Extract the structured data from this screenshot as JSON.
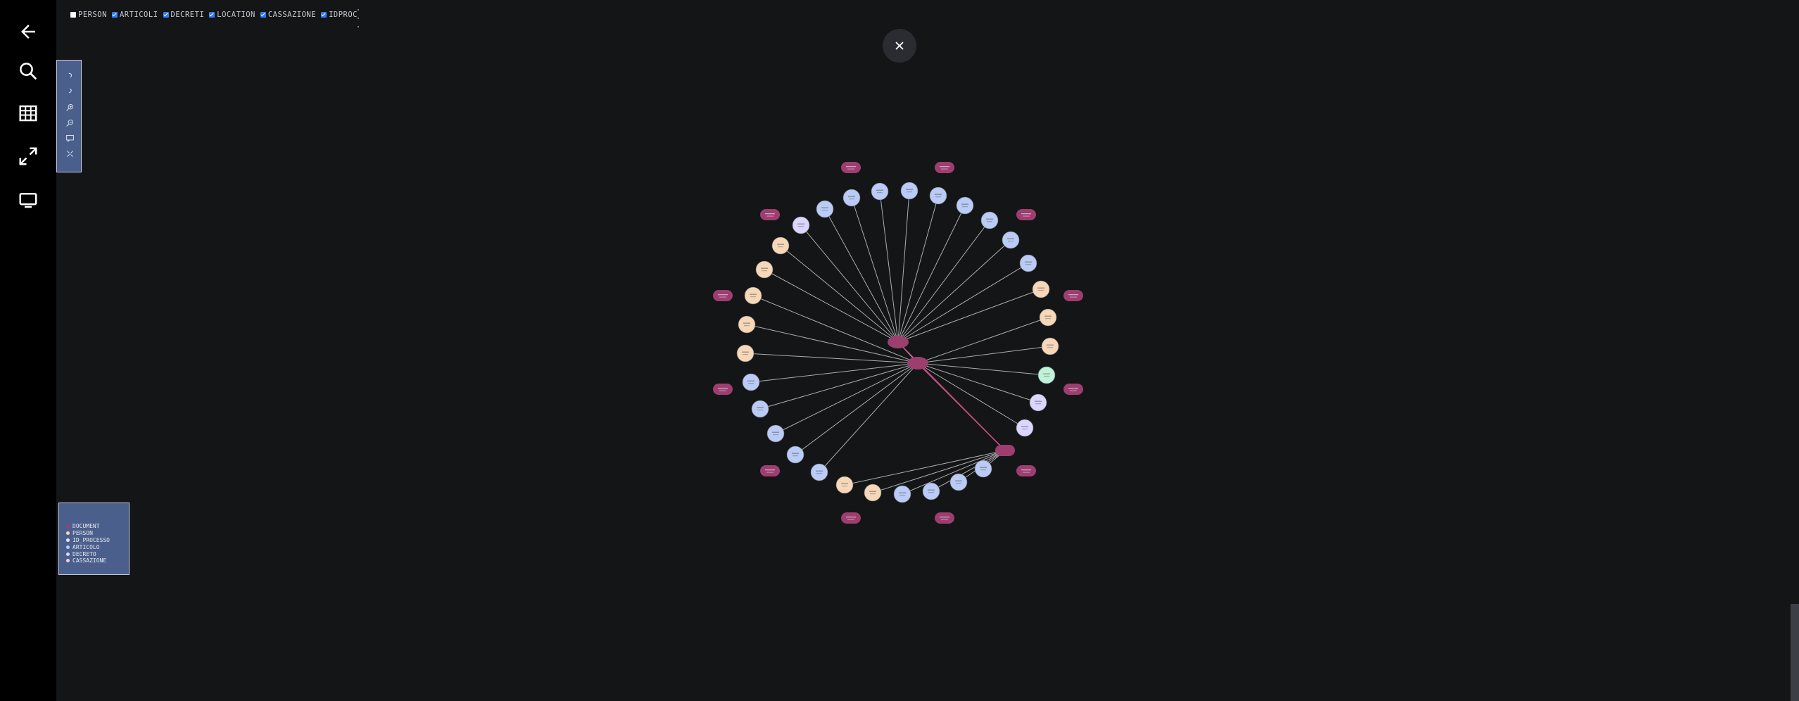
{
  "sidebar": {
    "items": [
      {
        "name": "back-arrow-icon",
        "label": "Back"
      },
      {
        "name": "search-icon",
        "label": "Search"
      },
      {
        "name": "table-icon",
        "label": "Table"
      },
      {
        "name": "expand-icon",
        "label": "Expand"
      },
      {
        "name": "monitor-icon",
        "label": "Monitor"
      }
    ]
  },
  "filters": [
    {
      "label": "PERSON",
      "checked": false
    },
    {
      "label": "ARTICOLI",
      "checked": true
    },
    {
      "label": "DECRETI",
      "checked": true
    },
    {
      "label": "LOCATION",
      "checked": true
    },
    {
      "label": "CASSAZIONE",
      "checked": true
    },
    {
      "label": "IDPROC",
      "checked": true
    }
  ],
  "toolbar": {
    "buttons": [
      "undo-icon",
      "redo-icon",
      "zoom-in-icon",
      "zoom-out-icon",
      "comment-icon",
      "fit-screen-icon"
    ]
  },
  "legend": {
    "items": [
      {
        "label": "DOCUMENT",
        "color": "#9c3f6e"
      },
      {
        "label": "PERSON",
        "color": "#f6d7b8"
      },
      {
        "label": "ID_PROCESSO",
        "color": "#e3e6ff"
      },
      {
        "label": "ARTICOLO",
        "color": "#b9cbf6"
      },
      {
        "label": "DECRETO",
        "color": "#dcd5ff"
      },
      {
        "label": "CASSAZIONE",
        "color": "#f1d5c8"
      }
    ]
  },
  "colors": {
    "background": "#141517",
    "sidebar": "#000000",
    "panel": "#4b5f8d",
    "document_node": "#9c3f6e",
    "articolo_node": "#b9cbf6",
    "person_node": "#f6d7b8",
    "decreto_node": "#dcd5ff",
    "location_node": "#bff2d9",
    "edge": "#c8c8c8",
    "edge_highlight": "#c74d84"
  }
}
